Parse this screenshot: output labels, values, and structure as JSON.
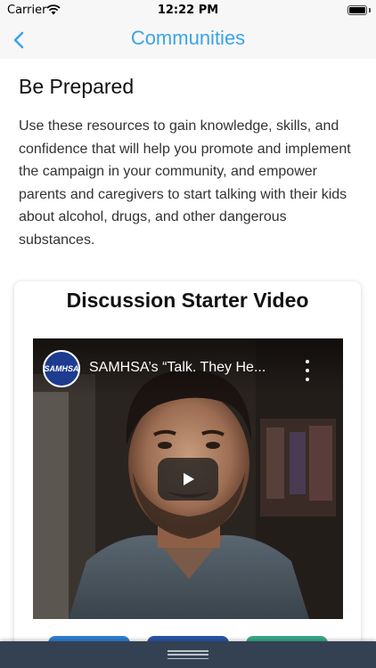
{
  "status_bar": {
    "carrier": "Carrier",
    "time": "12:22 PM"
  },
  "nav": {
    "title": "Communities",
    "back_icon": "chevron-left-icon"
  },
  "page": {
    "heading": "Be Prepared",
    "intro": "Use these resources to gain knowledge, skills, and confidence that will help you promote and implement the campaign in your community, and empower parents and caregivers to start talking with their kids about alcohol, drugs, and other dangerous substances."
  },
  "video_card": {
    "title": "Discussion Starter Video",
    "video": {
      "channel_logo_text": "SAMHSA",
      "title": "SAMHSA’s “Talk. They He...",
      "play_icon": "play-icon",
      "menu_icon": "more-vertical-icon"
    },
    "button_colors": [
      "#2f7fd1",
      "#2b56a8",
      "#3aa98a"
    ]
  },
  "colors": {
    "accent": "#3ba4e6",
    "bottom_bar": "#344152"
  }
}
